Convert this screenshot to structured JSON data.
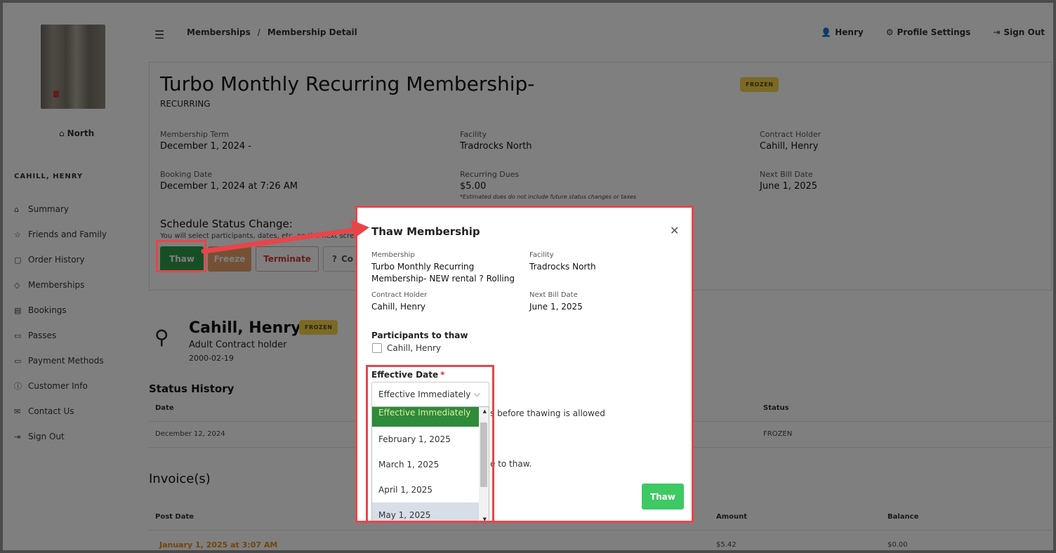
{
  "location": "North",
  "customer_name": "CAHILL, HENRY",
  "sidebar": {
    "items": [
      {
        "label": "Summary",
        "icon": "home-icon"
      },
      {
        "label": "Friends and Family",
        "icon": "star-icon"
      },
      {
        "label": "Order History",
        "icon": "bag-icon"
      },
      {
        "label": "Memberships",
        "icon": "tag-icon"
      },
      {
        "label": "Bookings",
        "icon": "calendar-icon"
      },
      {
        "label": "Passes",
        "icon": "ticket-icon"
      },
      {
        "label": "Payment Methods",
        "icon": "card-icon"
      },
      {
        "label": "Customer Info",
        "icon": "info-icon"
      },
      {
        "label": "Contact Us",
        "icon": "mail-icon"
      },
      {
        "label": "Sign Out",
        "icon": "signout-icon"
      }
    ]
  },
  "breadcrumb": {
    "first": "Memberships",
    "sep": "/",
    "current": "Membership Detail"
  },
  "topnav": {
    "user": "Henry",
    "profile": "Profile Settings",
    "signout": "Sign Out"
  },
  "membership": {
    "title": "Turbo Monthly Recurring Membership-",
    "subtitle": "RECURRING",
    "status": "FROZEN",
    "term_label": "Membership Term",
    "term_value": "December 1, 2024 -",
    "facility_label": "Facility",
    "facility_value": "Tradrocks North",
    "holder_label": "Contract Holder",
    "holder_value": "Cahill, Henry",
    "booking_label": "Booking Date",
    "booking_value": "December 1, 2024 at 7:26 AM",
    "dues_label": "Recurring Dues",
    "dues_value": "$5.00",
    "dues_note": "*Estimated dues do not include future status changes or taxes",
    "nextbill_label": "Next Bill Date",
    "nextbill_value": "June 1, 2025",
    "schedule_title": "Schedule Status Change:",
    "schedule_sub": "You will select participants, dates, etc. on the next screen",
    "buttons": {
      "thaw": "Thaw",
      "freeze": "Freeze",
      "terminate": "Terminate",
      "other": "Co"
    }
  },
  "person": {
    "name": "Cahill, Henry",
    "status": "FROZEN",
    "role": "Adult Contract holder",
    "dob": "2000-02-19"
  },
  "status_history": {
    "title": "Status History",
    "headers": {
      "date": "Date",
      "status": "Status"
    },
    "rows": [
      {
        "date": "December 12, 2024",
        "status": "FROZEN"
      }
    ]
  },
  "invoices": {
    "title": "Invoice(s)",
    "headers": {
      "post_date": "Post Date",
      "amount": "Amount",
      "balance": "Balance"
    },
    "rows": [
      {
        "post_date": "January 1, 2025 at 3:07 AM",
        "amount": "$5.42",
        "balance": "$0.00"
      }
    ]
  },
  "modal": {
    "title": "Thaw Membership",
    "membership_label": "Membership",
    "membership_value": "Turbo Monthly Recurring Membership- NEW rental ? Rolling",
    "facility_label": "Facility",
    "facility_value": "Tradrocks North",
    "holder_label": "Contract Holder",
    "holder_value": "Cahill, Henry",
    "nextbill_label": "Next Bill Date",
    "nextbill_value": "June 1, 2025",
    "participants_label": "Participants to thaw",
    "participant": "Cahill, Henry",
    "effective_label": "Effective Date",
    "required_mark": "*",
    "effective_selected": "Effective Immediately",
    "options": [
      "Effective Immediately",
      "February 1, 2025",
      "March 1, 2025",
      "April 1, 2025",
      "May 1, 2025"
    ],
    "hint1": "s before thawing is allowed",
    "hint2": "e to thaw.",
    "thaw_button": "Thaw"
  },
  "colors": {
    "thaw_green": "#2e9e4a",
    "freeze_orange": "#e8a36a",
    "terminate_red": "#d03a3a",
    "frozen_badge": "#f4d44b",
    "annotation_red": "#e8454b",
    "selected_option": "#2f8a3a"
  }
}
